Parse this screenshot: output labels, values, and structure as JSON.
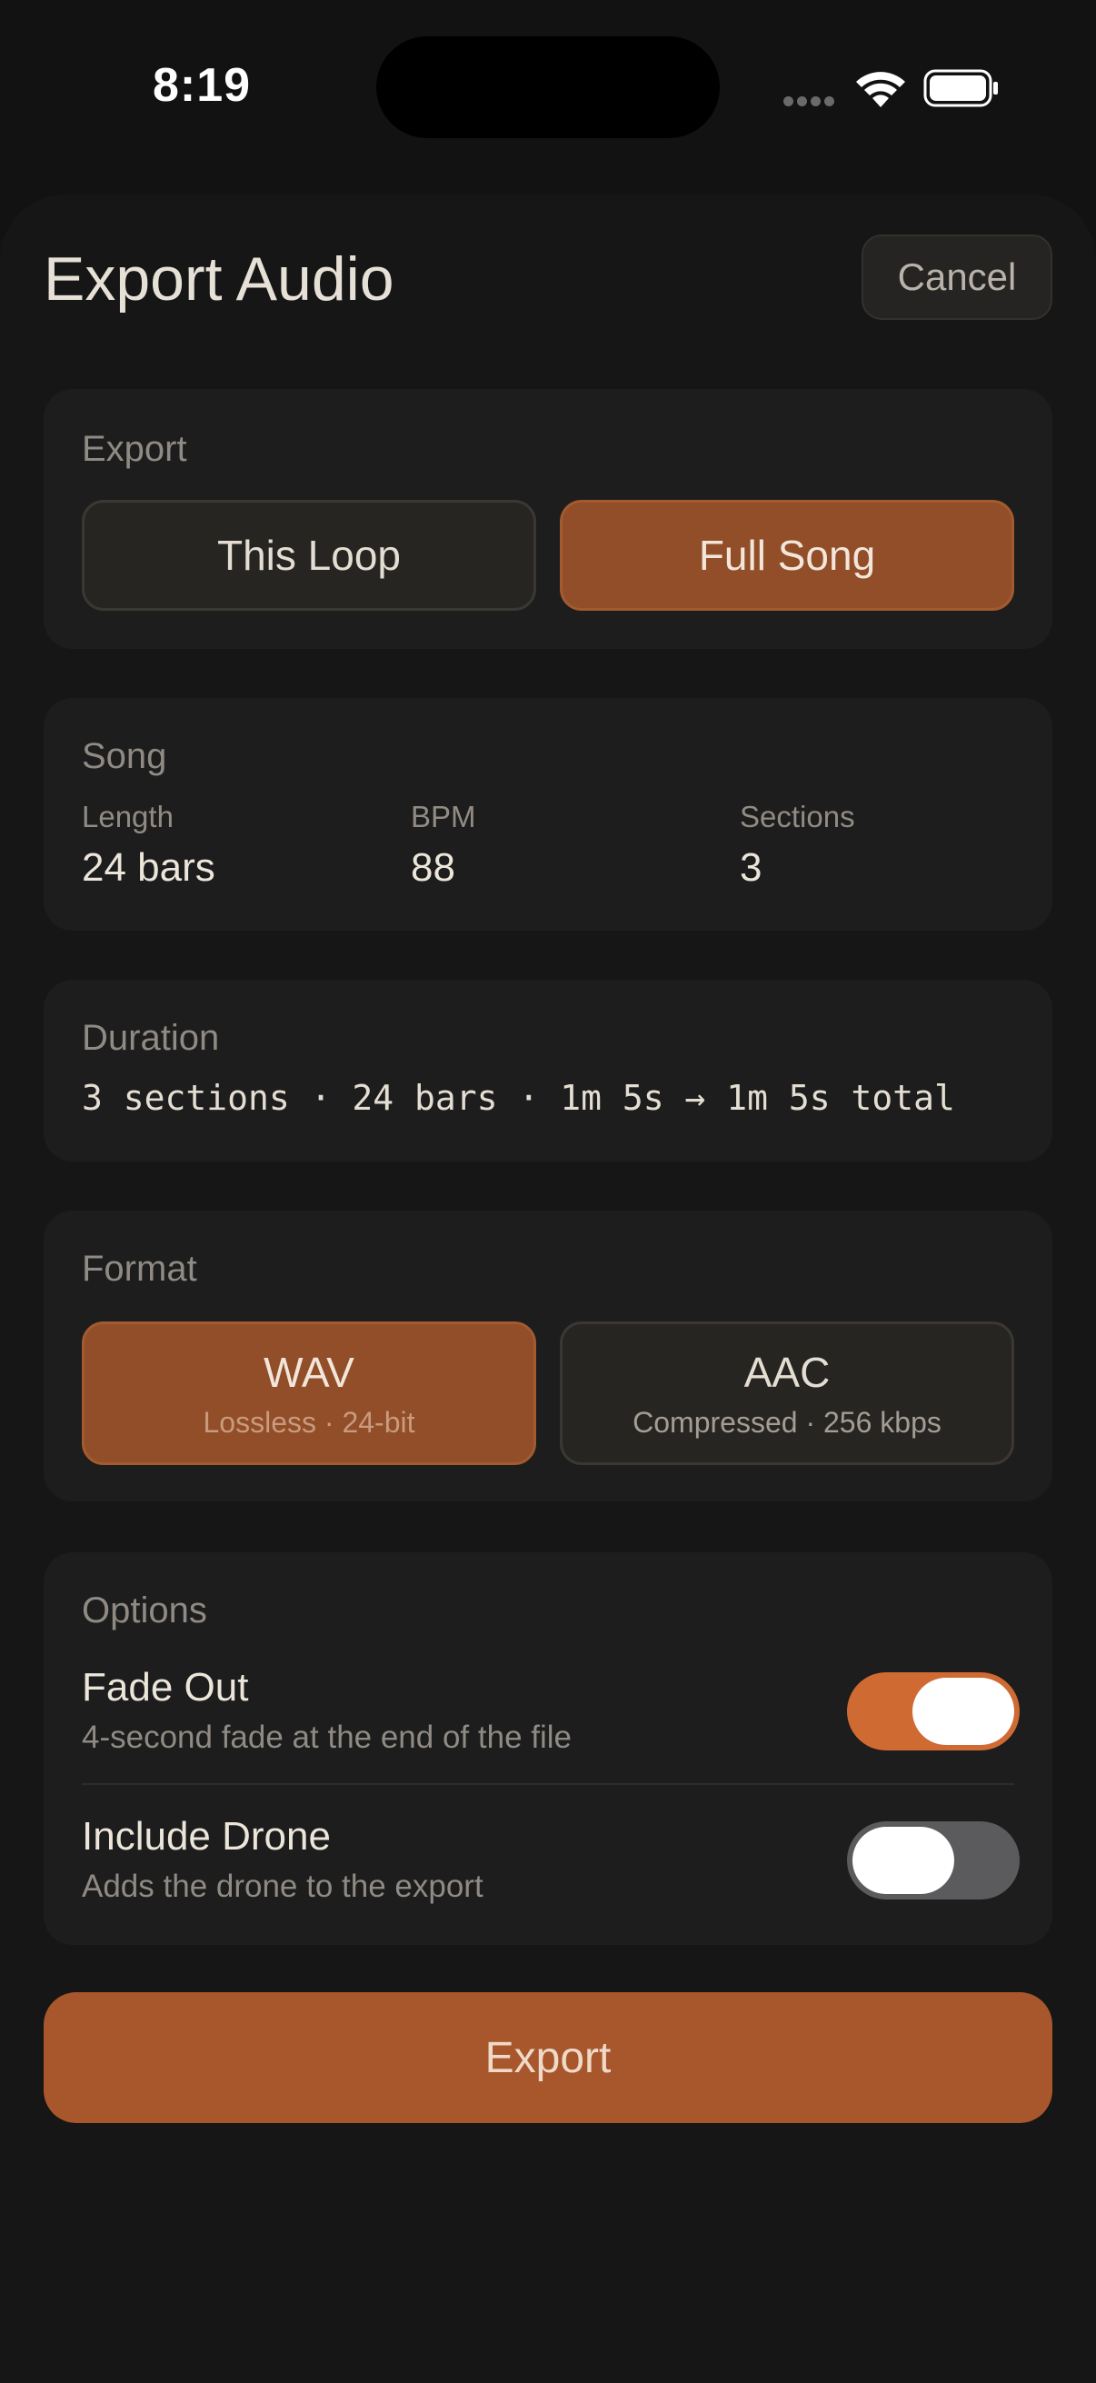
{
  "status_bar": {
    "time": "8:19"
  },
  "header": {
    "title": "Export Audio",
    "cancel_label": "Cancel"
  },
  "export_scope": {
    "label": "Export",
    "options": [
      "This Loop",
      "Full Song"
    ],
    "selected": "Full Song"
  },
  "song": {
    "label": "Song",
    "stats": [
      {
        "label": "Length",
        "value": "24 bars"
      },
      {
        "label": "BPM",
        "value": "88"
      },
      {
        "label": "Sections",
        "value": "3"
      }
    ]
  },
  "duration": {
    "label": "Duration",
    "summary": "3 sections · 24 bars · 1m 5s → 1m 5s total"
  },
  "format": {
    "label": "Format",
    "options": [
      {
        "name": "WAV",
        "detail": "Lossless · 24-bit"
      },
      {
        "name": "AAC",
        "detail": "Compressed · 256 kbps"
      }
    ],
    "selected": "WAV"
  },
  "options": {
    "label": "Options",
    "items": [
      {
        "title": "Fade Out",
        "description": "4-second fade at the end of the file",
        "enabled": true
      },
      {
        "title": "Include Drone",
        "description": "Adds the drone to the export",
        "enabled": false
      }
    ]
  },
  "export_button": {
    "label": "Export"
  },
  "colors": {
    "accent": "#cf6a33",
    "selected_segment": "#914e28",
    "export_button": "#a8572c",
    "background": "#121212",
    "card": "#1d1d1d"
  }
}
